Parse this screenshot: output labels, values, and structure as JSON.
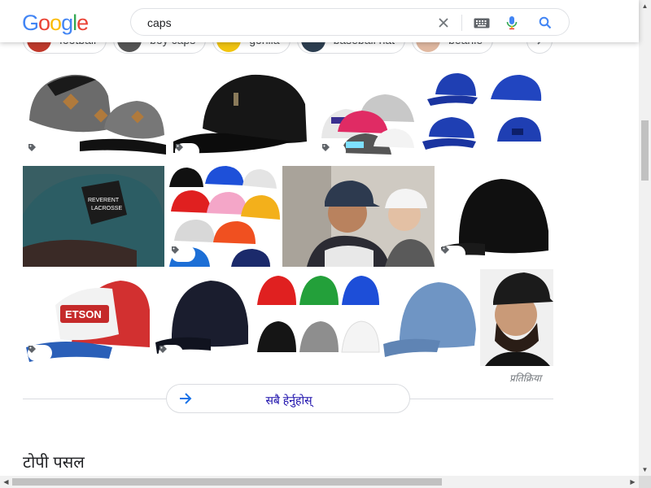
{
  "header": {
    "logo_letters": [
      {
        "ch": "G",
        "color": "#4285F4"
      },
      {
        "ch": "o",
        "color": "#EA4335"
      },
      {
        "ch": "o",
        "color": "#FBBC05"
      },
      {
        "ch": "g",
        "color": "#4285F4"
      },
      {
        "ch": "l",
        "color": "#34A853"
      },
      {
        "ch": "e",
        "color": "#EA4335"
      }
    ],
    "search_value": "caps",
    "icons": {
      "clear": "close-icon",
      "keyboard": "keyboard-icon",
      "voice": "microphone-icon",
      "search": "search-icon"
    }
  },
  "chips": [
    {
      "label": "football",
      "thumb_color": "#c0392b"
    },
    {
      "label": "boy caps",
      "thumb_color": "#555555"
    },
    {
      "label": "gorilla",
      "thumb_color": "#f1c40f"
    },
    {
      "label": "baseball hat",
      "thumb_color": "#2c3e50"
    },
    {
      "label": "beanie",
      "thumb_color": "#e0b8a0"
    }
  ],
  "results": {
    "tiles": [
      {
        "name": "grey-snapback-caps",
        "bg": "#ffffff",
        "cap": "#6b6b6b",
        "tag": true
      },
      {
        "name": "black-cap-side",
        "bg": "#ffffff",
        "cap": "#151515",
        "tag": true
      },
      {
        "name": "trucker-caps-multi",
        "bg": "#ffffff",
        "cap": "#9a9a9a",
        "tag": true
      },
      {
        "name": "blue-caps-angles",
        "bg": "#ffffff",
        "cap": "#1f3fb3",
        "tag": false
      },
      {
        "name": "lacrosse-cap-teal",
        "bg": "#3c6e73",
        "cap": "#2d5a60",
        "tag": false
      },
      {
        "name": "colorful-caps-pile",
        "bg": "#ffffff",
        "cap": "#d63031",
        "tag": true
      },
      {
        "name": "couple-wearing-caps",
        "bg": "#c9c4bd",
        "cap": "#2d3a4f",
        "tag": false
      },
      {
        "name": "black-cap-front",
        "bg": "#ffffff",
        "cap": "#111111",
        "tag": true
      },
      {
        "name": "stetson-trucker-cap",
        "bg": "#ffffff",
        "cap": "#d03030",
        "tag": true
      },
      {
        "name": "navy-cap",
        "bg": "#ffffff",
        "cap": "#1a1d2e",
        "tag": true
      },
      {
        "name": "six-color-caps",
        "bg": "#ffffff",
        "cap": "#2ea043",
        "tag": false
      },
      {
        "name": "light-blue-cap",
        "bg": "#ffffff",
        "cap": "#6f95c4",
        "tag": false
      },
      {
        "name": "man-black-cap",
        "bg": "#f2f2f2",
        "cap": "#1b1b1b",
        "tag": false
      }
    ],
    "feedback_label": "प्रतिक्रिया"
  },
  "see_all": {
    "label": "सबै हेर्नुहोस्",
    "icon": "arrow-right-icon",
    "accent": "#1a73e8"
  },
  "section": {
    "title": "टोपी पसल"
  }
}
